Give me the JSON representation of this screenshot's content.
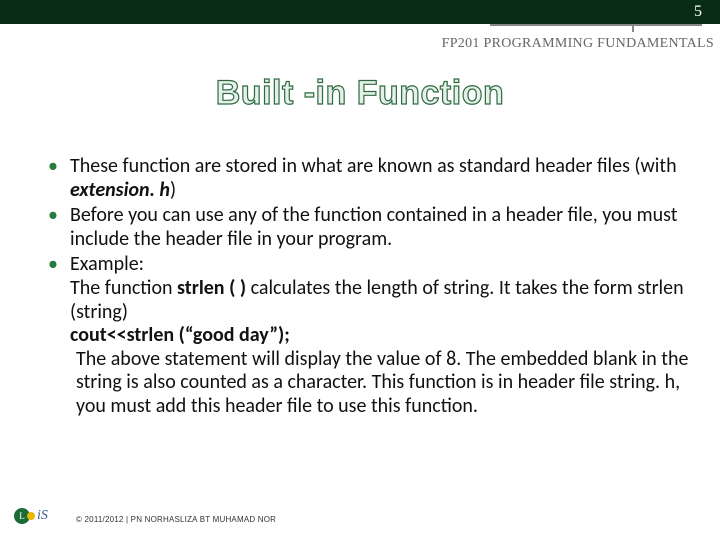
{
  "page_number": "5",
  "course_code": "FP201 PROGRAMMING FUNDAMENTALS",
  "title": "Built -in Function",
  "bullets": {
    "b1_part1": "These function are stored in what are known as standard header files (with ",
    "b1_ext": "extension. h",
    "b1_part2": ")",
    "b2": "Before you can use any of the function contained in a header file, you must include the header file in your program.",
    "b3_label": "Example:",
    "b3_l1a": "The function ",
    "b3_l1b": "strlen ( )",
    "b3_l1c": " calculates the length of string. It takes the form strlen (string)",
    "b3_l2": "cout<<strlen (“good day”);",
    "b3_l3": " The above statement will display the value of 8. The embedded blank in the string is also counted as a character.  This function is in header file string. h, you must add this header file to use this function."
  },
  "logo_text": "iS",
  "copyright": "© 2011/2012 | PN NORHASLIZA BT MUHAMAD NOR"
}
